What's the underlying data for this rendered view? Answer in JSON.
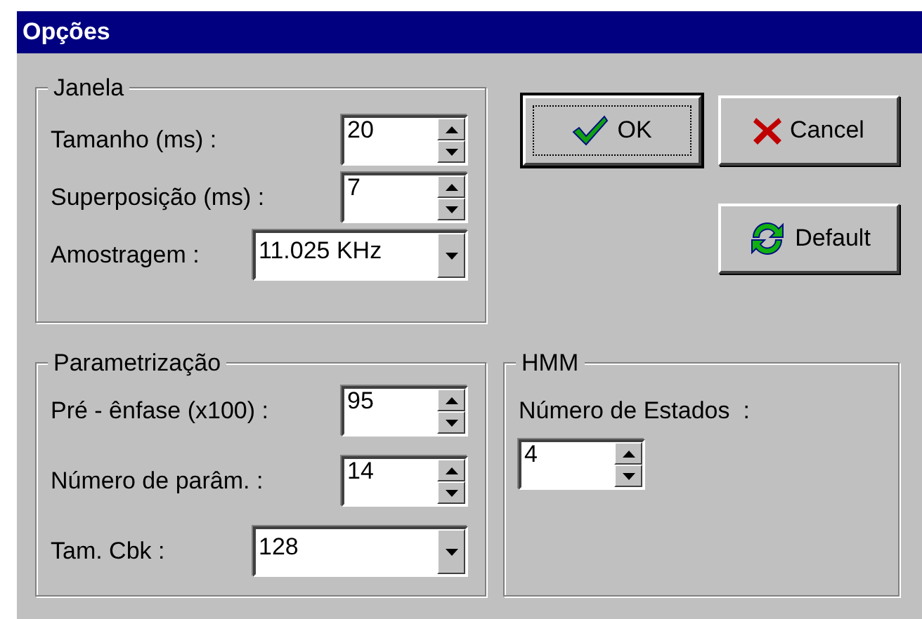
{
  "window": {
    "title": "Opções"
  },
  "janela": {
    "title": "Janela",
    "fields": [
      {
        "kind": "spin",
        "label": "Tamanho (ms) :",
        "value": "20"
      },
      {
        "kind": "spin",
        "label": "Superposição (ms) :",
        "value": "7"
      },
      {
        "kind": "combo",
        "label": "Amostragem :",
        "value": "11.025 KHz"
      }
    ]
  },
  "buttons": [
    {
      "kind": "ok",
      "label": "OK",
      "focused": true
    },
    {
      "kind": "cancel",
      "label": "Cancel",
      "focused": false
    },
    {
      "kind": "default",
      "label": "Default",
      "focused": false
    }
  ],
  "parametrizacao": {
    "title": "Parametrização",
    "fields": [
      {
        "kind": "spin",
        "label": "Pré - ênfase (x100) :",
        "value": "95"
      },
      {
        "kind": "spin",
        "label": "Número de parâm. :",
        "value": "14"
      },
      {
        "kind": "combo",
        "label": "Tam. Cbk :",
        "value": "128"
      }
    ]
  },
  "hmm": {
    "title": "HMM",
    "label": "Número de Estados  :",
    "value": "4"
  }
}
